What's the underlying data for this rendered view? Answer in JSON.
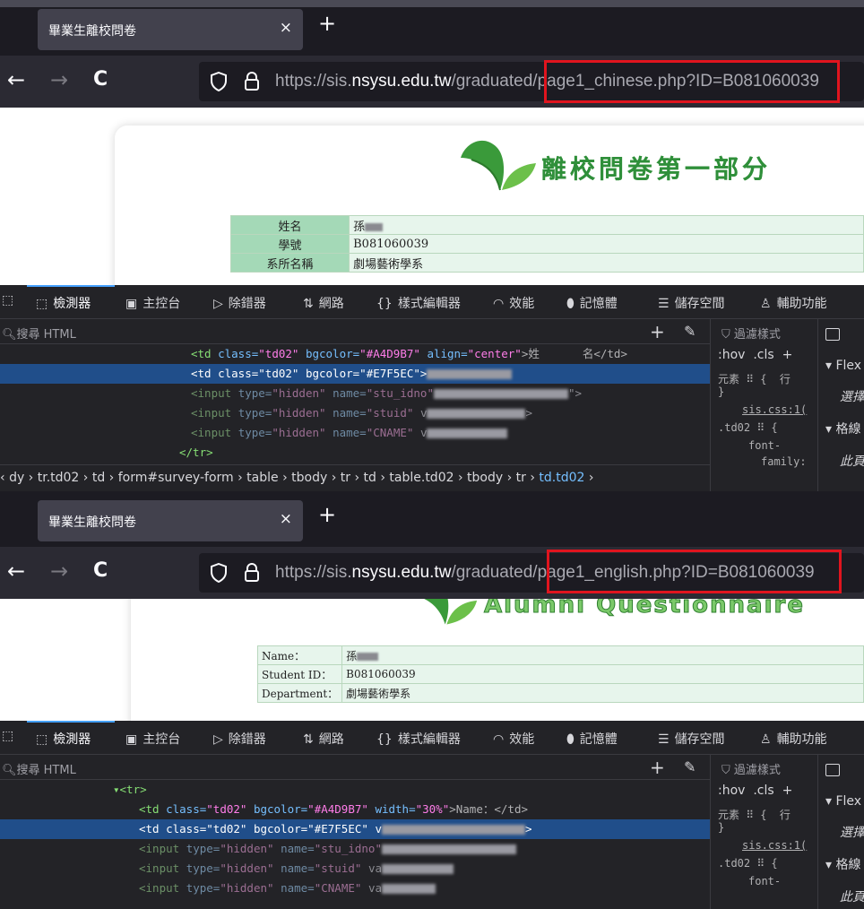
{
  "panel1": {
    "tab_title": "畢業生離校問卷",
    "tab_close": "×",
    "new_tab": "+",
    "nav": {
      "back": "←",
      "forward": "→",
      "reload": "C"
    },
    "url": {
      "prefix": "https://sis.",
      "domain": "nsysu.edu.tw",
      "path": "/graduated/",
      "page": "page1_chinese.php?ID=B081060039"
    },
    "banner": "離校問卷第一部分",
    "form": [
      {
        "label": "姓名",
        "value": "孫"
      },
      {
        "label": "學號",
        "value": "B081060039"
      },
      {
        "label": "系所名稱",
        "value": "劇場藝術學系"
      }
    ],
    "devtools": {
      "tabs": [
        "檢測器",
        "主控台",
        "除錯器",
        "網路",
        "樣式編輯器",
        "效能",
        "記憶體",
        "儲存空間",
        "輔助功能"
      ],
      "search_placeholder": "搜尋 HTML",
      "lines": {
        "l1_tag1": "<td",
        "l1_class_attr": "class=",
        "l1_class_val": "\"td02\"",
        "l1_bg_attr": "bgcolor=",
        "l1_bg_val": "\"#A4D9B7\"",
        "l1_align_attr": "align=",
        "l1_align_val": "\"center\"",
        "l1_text_a": ">姓",
        "l1_text_b": "名</td>",
        "l2_tag1": "<td",
        "l2_class_attr": "class=",
        "l2_class_val": "\"td02\"",
        "l2_bg_attr": "bgcolor=",
        "l2_bg_val": "\"#E7F5EC\"",
        "l2_tail": ">",
        "l3_tag1": "<input",
        "l3_type_attr": "type=",
        "l3_type_val": "\"hidden\"",
        "l3_name_attr": "name=",
        "l3_name_val": "\"stu_idno\"",
        "l3_tail": "\">",
        "l4_tag1": "<input",
        "l4_type_attr": "type=",
        "l4_type_val": "\"hidden\"",
        "l4_name_attr": "name=",
        "l4_name_val": "\"stuid\"",
        "l4_v": "v",
        "l4_tail": ">",
        "l5_tag1": "<input",
        "l5_type_attr": "type=",
        "l5_type_val": "\"hidden\"",
        "l5_name_attr": "name=",
        "l5_name_val": "\"CNAME\"",
        "l5_v": "v",
        "l6": "</tr>"
      },
      "breadcrumbs": [
        "dy",
        "tr.td02",
        "td",
        "form#survey-form",
        "table",
        "tbody",
        "tr",
        "td",
        "table.td02",
        "tbody",
        "tr",
        "td.td02"
      ],
      "side": {
        "filter": "過濾樣式",
        "hov": ":hov",
        "cls": ".cls",
        "plus": "+",
        "rule1a": "元素 ⠿ {",
        "rule1b": "行",
        "rule1c": "}",
        "link": "sis.css:1(",
        "rule2a": ".td02 ⠿ {",
        "rule2b": "font-",
        "rule2c": "family:"
      },
      "side_right": {
        "flex": "Flex",
        "sel": "選擇",
        "grid": "格線",
        "page": "此頁"
      }
    }
  },
  "panel2": {
    "tab_title": "畢業生離校問卷",
    "tab_close": "×",
    "new_tab": "+",
    "nav": {
      "back": "←",
      "forward": "→",
      "reload": "C"
    },
    "url": {
      "prefix": "https://sis.",
      "domain": "nsysu.edu.tw",
      "path": "/graduated/",
      "page": "page1_english.php?ID=B081060039"
    },
    "banner": "Alumni Questionnaire",
    "form": [
      {
        "label": "Name：",
        "value": "孫"
      },
      {
        "label": "Student ID：",
        "value": "B081060039"
      },
      {
        "label": "Department：",
        "value": "劇場藝術學系"
      }
    ],
    "devtools": {
      "tabs": [
        "檢測器",
        "主控台",
        "除錯器",
        "網路",
        "樣式編輯器",
        "效能",
        "記憶體",
        "儲存空間",
        "輔助功能"
      ],
      "search_placeholder": "搜尋 HTML",
      "lines": {
        "l0": "▾<tr>",
        "l1_tag1": "<td",
        "l1_class_attr": "class=",
        "l1_class_val": "\"td02\"",
        "l1_bg_attr": "bgcolor=",
        "l1_bg_val": "\"#A4D9B7\"",
        "l1_w_attr": "width=",
        "l1_w_val": "\"30%\"",
        "l1_text": ">Name：</td>",
        "l2_tag1": "<td",
        "l2_class_attr": "class=",
        "l2_class_val": "\"td02\"",
        "l2_bg_attr": "bgcolor=",
        "l2_bg_val": "\"#E7F5EC\"",
        "l2_v": "v",
        "l2_tail": ">",
        "l3_tag1": "<input",
        "l3_type_attr": "type=",
        "l3_type_val": "\"hidden\"",
        "l3_name_attr": "name=",
        "l3_name_val": "\"stu_idno\"",
        "l4_tag1": "<input",
        "l4_type_attr": "type=",
        "l4_type_val": "\"hidden\"",
        "l4_name_attr": "name=",
        "l4_name_val": "\"stuid\"",
        "l4_v": "va",
        "l5_tag1": "<input",
        "l5_type_attr": "type=",
        "l5_type_val": "\"hidden\"",
        "l5_name_attr": "name=",
        "l5_name_val": "\"CNAME\"",
        "l5_v": "va"
      },
      "side": {
        "filter": "過濾樣式",
        "hov": ":hov",
        "cls": ".cls",
        "plus": "+",
        "rule1a": "元素 ⠿ {",
        "rule1b": "行",
        "rule1c": "}",
        "link": "sis.css:1(",
        "rule2a": ".td02 ⠿ {",
        "rule2b": "font-"
      },
      "side_right": {
        "flex": "Flex",
        "sel": "選擇",
        "grid": "格線",
        "page": "此頁"
      }
    }
  },
  "colors": {
    "highlight_box": "#e0141e",
    "label_cell": "#A4D9B7",
    "value_cell": "#E7F5EC",
    "selected_line": "#204e8a"
  }
}
